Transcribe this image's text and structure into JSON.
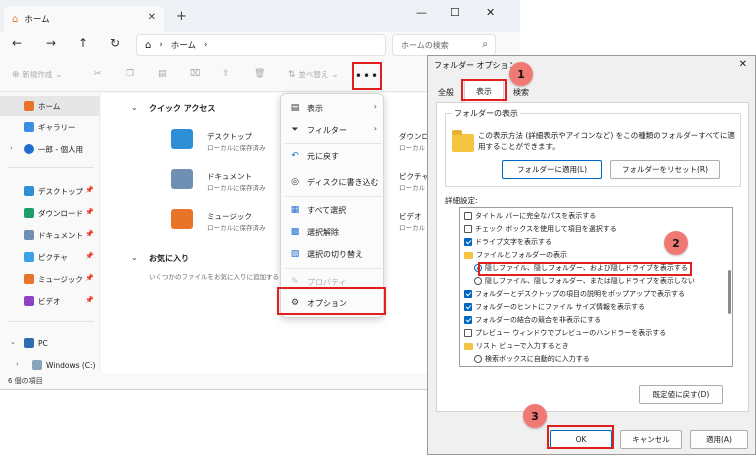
{
  "explorer": {
    "tab_title": "ホーム",
    "address_path": "ホーム",
    "search_placeholder": "ホームの検索",
    "toolbar": {
      "new_label": "新規作成",
      "sort_label": "並べ替え",
      "more_label": "•••"
    },
    "sidebar": {
      "home": "ホーム",
      "gallery": "ギャラリー",
      "onedrive": "一郎 - 個人用",
      "desktop": "デスクトップ",
      "downloads": "ダウンロード",
      "documents": "ドキュメント",
      "pictures": "ピクチャ",
      "music": "ミュージック",
      "videos": "ビデオ",
      "pc": "PC",
      "windows": "Windows (C:)"
    },
    "quick_access_title": "クイック アクセス",
    "quick_access": [
      {
        "name": "デスクトップ",
        "sub": "ローカルに保存済み",
        "color": "#2f8fd6"
      },
      {
        "name": "ドキュメント",
        "sub": "ローカルに保存済み",
        "color": "#6f8fb3"
      },
      {
        "name": "ミュージック",
        "sub": "ローカルに保存済み",
        "color": "#e8742a"
      }
    ],
    "quick_access_right": [
      {
        "name": "ダウンロー",
        "sub": "ローカル"
      },
      {
        "name": "ピクチャ",
        "sub": "ローカル"
      },
      {
        "name": "ビデオ",
        "sub": "ローカル"
      }
    ],
    "favorites_title": "お気に入り",
    "favorites_empty": "いくつかのファイルをお気に入りに追加すると、",
    "status": "6 個の項目"
  },
  "menu": {
    "items": [
      {
        "icon": "view-icon",
        "label": "表示",
        "arrow": true
      },
      {
        "icon": "filter-icon",
        "label": "フィルター",
        "arrow": true
      },
      {
        "icon": "undo-icon",
        "label": "元に戻す"
      },
      {
        "icon": "disc-icon",
        "label": "ディスクに書き込む"
      },
      {
        "icon": "select-all-icon",
        "label": "すべて選択"
      },
      {
        "icon": "select-none-icon",
        "label": "選択解除"
      },
      {
        "icon": "invert-selection-icon",
        "label": "選択の切り替え"
      },
      {
        "icon": "properties-icon",
        "label": "プロパティ"
      },
      {
        "icon": "options-icon",
        "label": "オプション"
      }
    ]
  },
  "dialog": {
    "title": "フォルダー オプション",
    "tabs": [
      "全般",
      "表示",
      "検索"
    ],
    "group_label": "フォルダーの表示",
    "group_desc": "この表示方法 (詳細表示やアイコンなど) をこの種類のフォルダーすべてに適用することができます。",
    "apply_folders": "フォルダーに適用(L)",
    "reset_folders": "フォルダーをリセット(R)",
    "advanced_label": "詳細設定:",
    "advanced": [
      "タイトル バーに完全なパスを表示する",
      "チェック ボックスを使用して項目を選択する",
      "ドライブ文字を表示する",
      "ファイルとフォルダーの表示",
      "隠しファイル、隠しフォルダー、および隠しドライブを表示する",
      "隠しファイル、隠しフォルダー、または隠しドライブを表示しない",
      "フォルダーとデスクトップの項目の説明をポップアップで表示する",
      "フォルダーのヒントにファイル サイズ情報を表示する",
      "フォルダーの結合の競合を非表示にする",
      "プレビュー ウィンドウでプレビューのハンドラーを表示する",
      "リスト ビューで入力するとき",
      "検索ボックスに自動的に入力する"
    ],
    "restore_defaults": "既定値に戻す(D)",
    "ok": "OK",
    "cancel": "キャンセル",
    "apply": "適用(A)"
  },
  "badges": [
    "1",
    "2",
    "3"
  ],
  "colors": {
    "highlight": "#e02020",
    "badge": "#f07a73",
    "accent": "#0067c0"
  }
}
